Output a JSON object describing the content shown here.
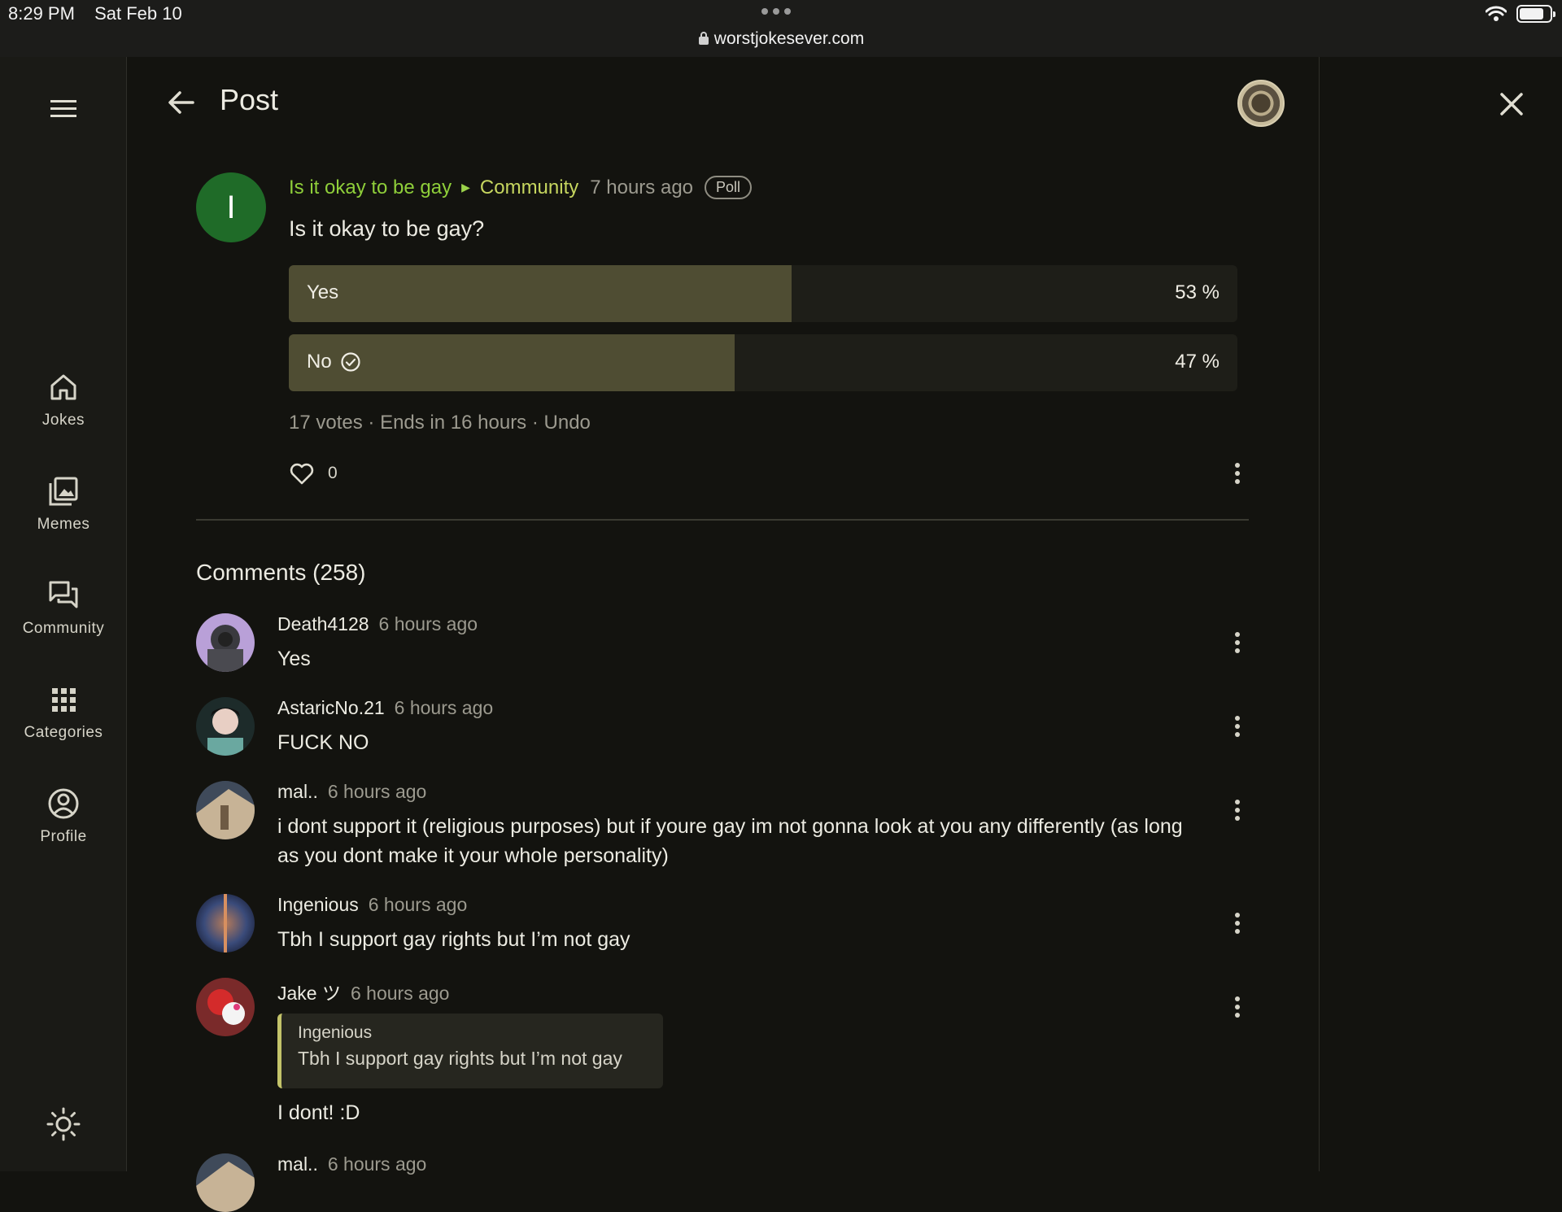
{
  "status": {
    "time": "8:29 PM",
    "date": "Sat Feb 10",
    "url": "worstjokesever.com"
  },
  "nav": {
    "items": [
      {
        "label": "Jokes",
        "icon": "home-icon"
      },
      {
        "label": "Memes",
        "icon": "image-gallery-icon"
      },
      {
        "label": "Community",
        "icon": "chat-bubbles-icon"
      },
      {
        "label": "Categories",
        "icon": "grid-icon"
      },
      {
        "label": "Profile",
        "icon": "user-circle-icon"
      }
    ]
  },
  "header": {
    "title": "Post"
  },
  "post": {
    "avatar_letter": "I",
    "group": "Is it okay to be gay",
    "community": "Community",
    "time": "7 hours ago",
    "badge": "Poll",
    "question": "Is it okay to be gay?",
    "options": [
      {
        "label": "Yes",
        "percent_text": "53 %",
        "fraction": 0.53,
        "selected": false
      },
      {
        "label": "No",
        "percent_text": "47 %",
        "fraction": 0.47,
        "selected": true
      }
    ],
    "votes": "17 votes",
    "ends": "Ends in 16 hours",
    "undo": "Undo",
    "likes": "0"
  },
  "comments": {
    "title": "Comments (258)",
    "items": [
      {
        "user": "Death4128",
        "time": "6 hours ago",
        "body": "Yes"
      },
      {
        "user": "AstaricNo.21",
        "time": "6 hours ago",
        "body": "FUCK NO"
      },
      {
        "user": "mal..",
        "time": "6 hours ago",
        "body": "i dont support it (religious purposes) but if youre gay im not gonna look at you any differently (as long as you dont make it your whole personality)"
      },
      {
        "user": "Ingenious",
        "time": "6 hours ago",
        "body": "Tbh I support gay rights but I’m not gay"
      },
      {
        "user": "Jake ツ",
        "time": "6 hours ago",
        "quote_user": "Ingenious",
        "quote_text": "Tbh I support gay rights but I’m not gay",
        "body": "I dont! :D"
      },
      {
        "user": "mal..",
        "time": "6 hours ago"
      }
    ]
  },
  "colors": {
    "background": "#13130f",
    "rail": "#1a1a16",
    "accent_green": "#8fcf3a",
    "poll_fill": "#4f4d33",
    "quote_accent": "#c4c46a"
  }
}
